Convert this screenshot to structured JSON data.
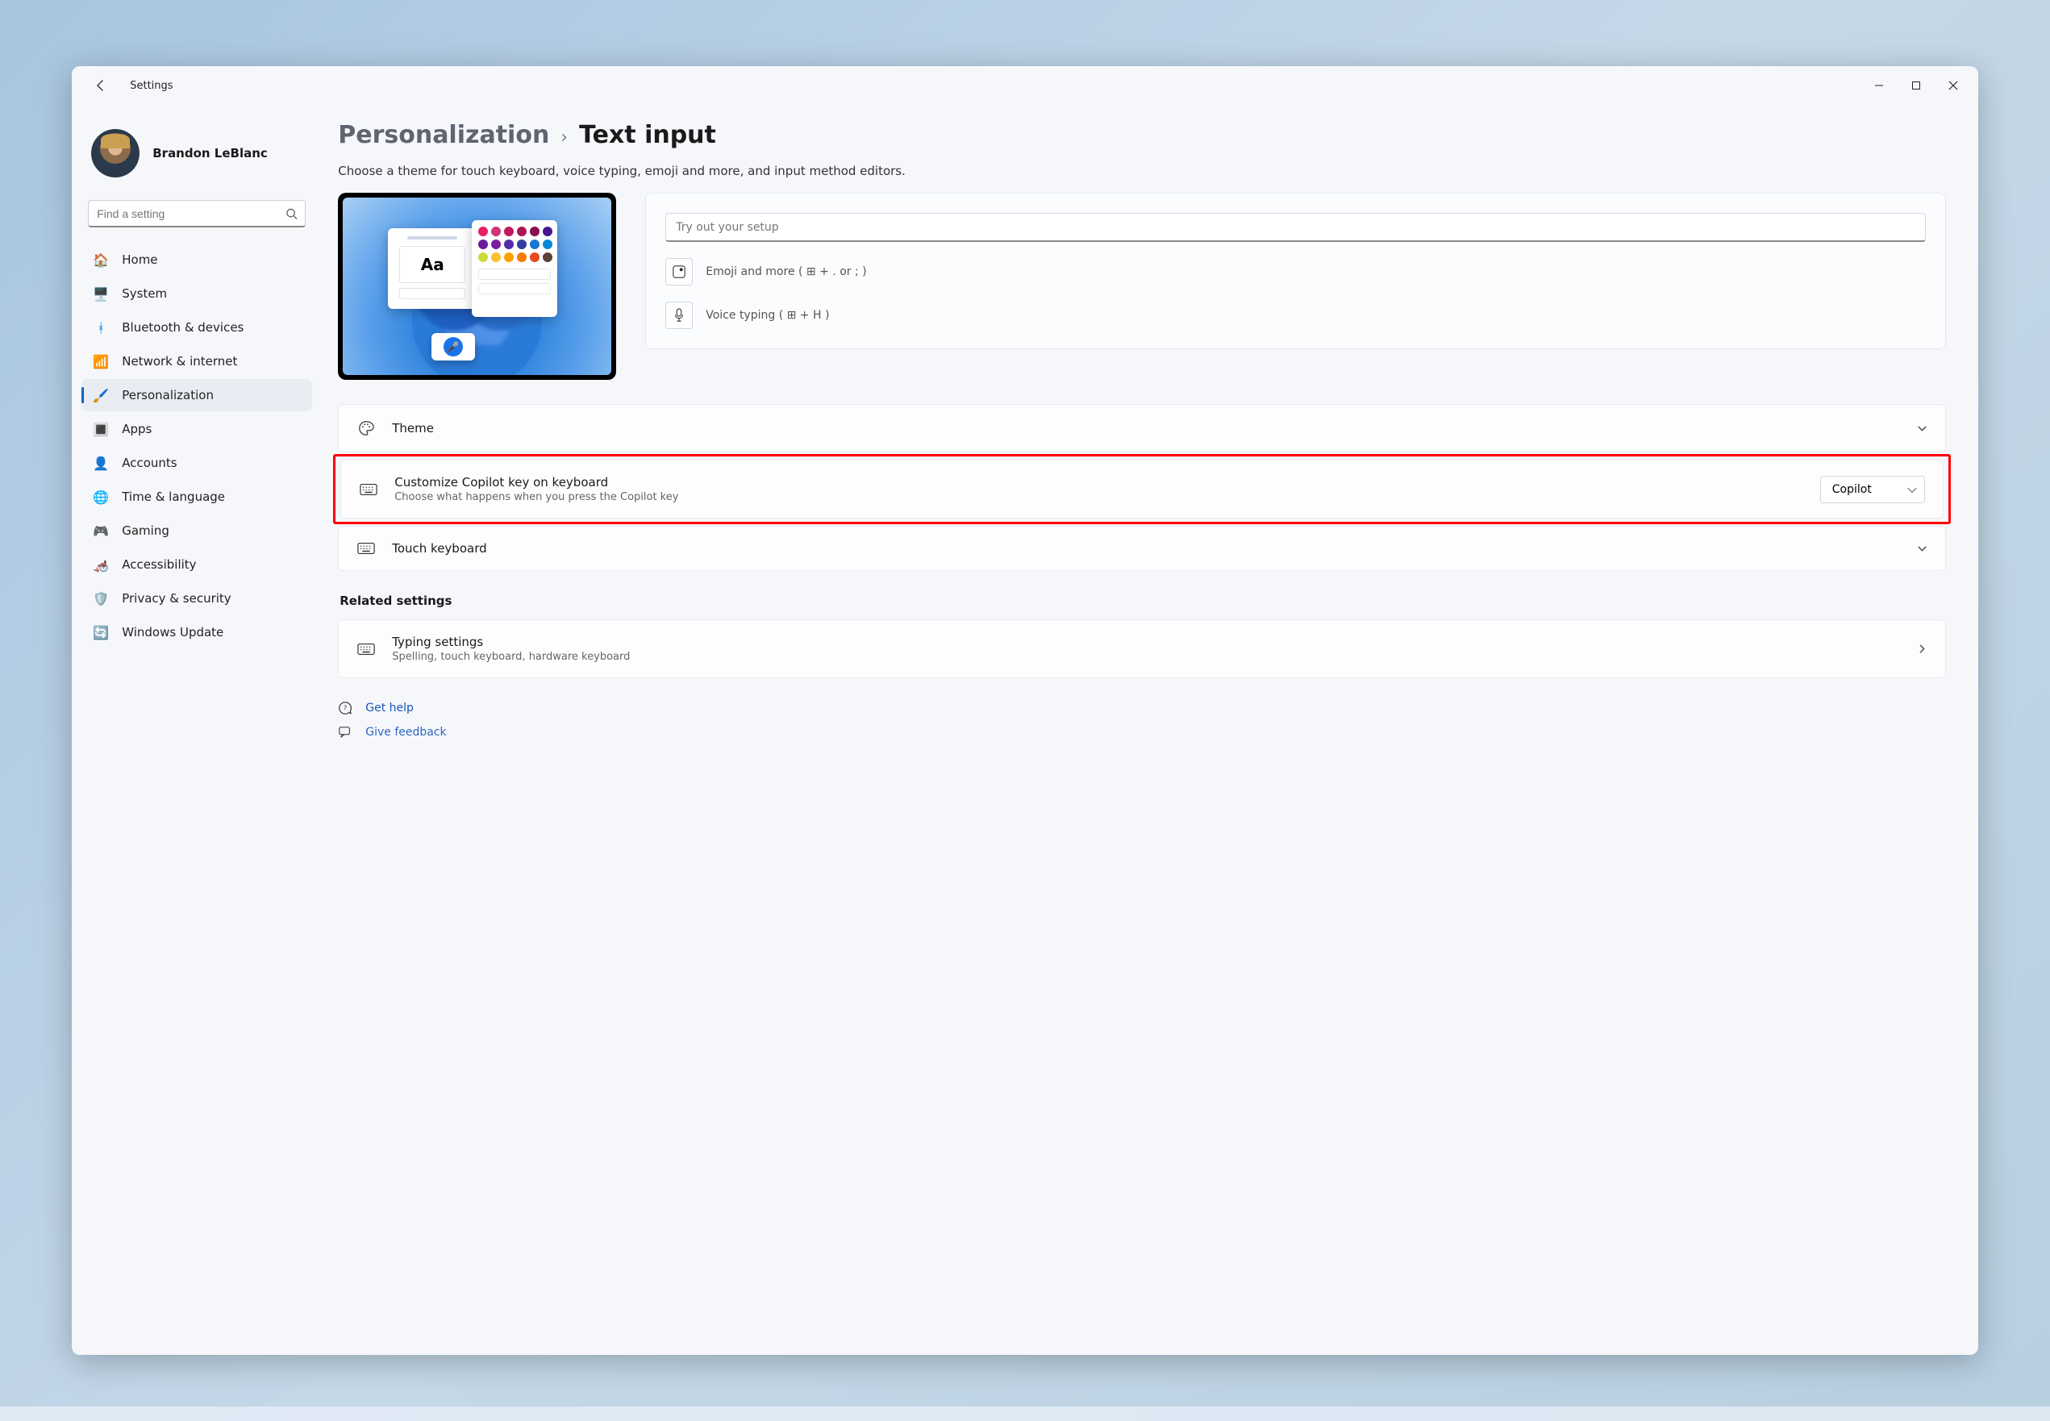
{
  "app_title": "Settings",
  "user_name": "Brandon LeBlanc",
  "search_placeholder": "Find a setting",
  "nav": {
    "home": "Home",
    "system": "System",
    "bluetooth": "Bluetooth & devices",
    "network": "Network & internet",
    "personalization": "Personalization",
    "apps": "Apps",
    "accounts": "Accounts",
    "time": "Time & language",
    "gaming": "Gaming",
    "accessibility": "Accessibility",
    "privacy": "Privacy & security",
    "update": "Windows Update"
  },
  "breadcrumb": {
    "parent": "Personalization",
    "current": "Text input"
  },
  "subtitle": "Choose a theme for touch keyboard, voice typing, emoji and more, and input method editors.",
  "preview_aa": "Aa",
  "tryout": {
    "placeholder": "Try out your setup",
    "emoji_label": "Emoji and more ( ⊞ + . or ; )",
    "voice_label": "Voice typing ( ⊞ + H )"
  },
  "cards": {
    "theme": "Theme",
    "copilot_title": "Customize Copilot key on keyboard",
    "copilot_sub": "Choose what happens when you press the Copilot key",
    "copilot_value": "Copilot",
    "touch_kb": "Touch keyboard"
  },
  "related_heading": "Related settings",
  "typing": {
    "title": "Typing settings",
    "sub": "Spelling, touch keyboard, hardware keyboard"
  },
  "footer": {
    "help": "Get help",
    "feedback": "Give feedback"
  },
  "palette_colors": [
    "#e91e63",
    "#d2337a",
    "#c2185b",
    "#ad1457",
    "#880e4f",
    "#4a148c",
    "#6a1b9a",
    "#7b1fa2",
    "#512da8",
    "#303f9f",
    "#1976d2",
    "#0288d1",
    "#cddc39",
    "#fbc02d",
    "#ffa000",
    "#f57c00",
    "#e64a19",
    "#5d4037"
  ]
}
